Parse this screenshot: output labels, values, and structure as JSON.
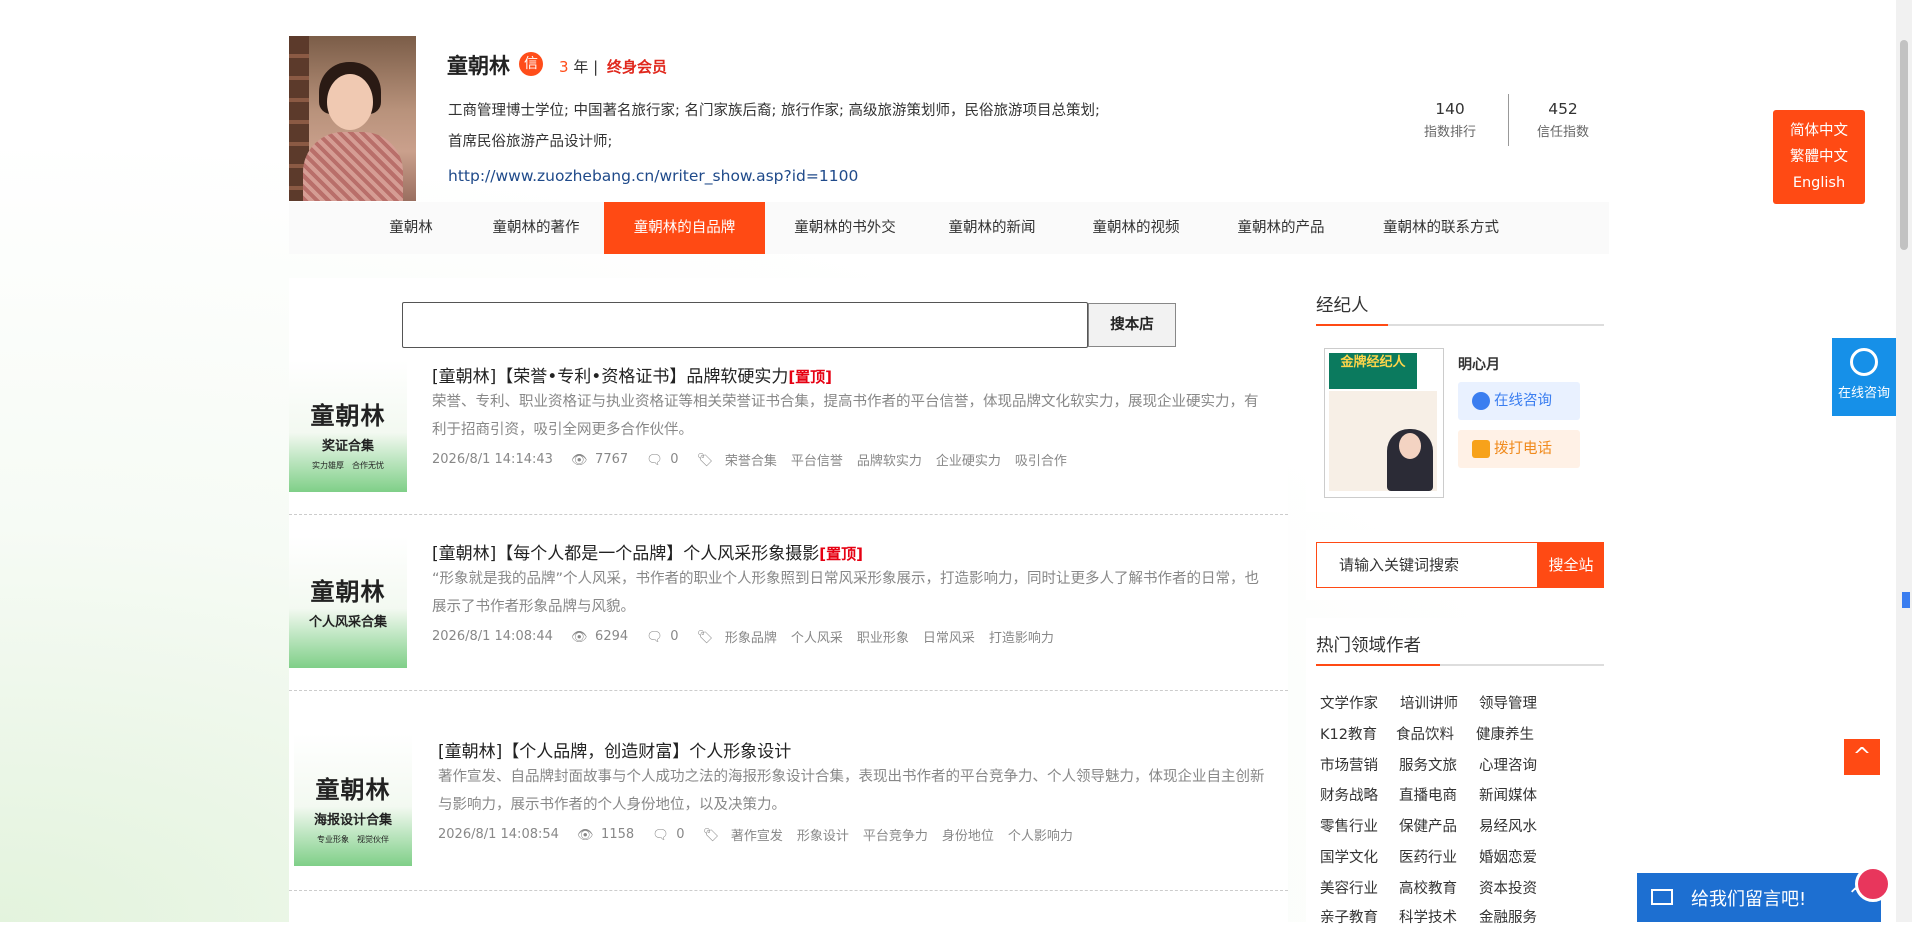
{
  "profile": {
    "name": "童朝林",
    "badge": "信",
    "years_num": "3",
    "years_unit": "年 |",
    "member": "终身会员",
    "bio_line1": "工商管理博士学位; 中国著名旅行家; 名门家族后裔; 旅行作家; 高级旅游策划师，民俗旅游项目总策划;",
    "bio_line2": "首席民俗旅游产品设计师;",
    "url": "http://www.zuozhebang.cn/writer_show.asp?id=1100",
    "stats": [
      {
        "value": "140",
        "label": "指数排行"
      },
      {
        "value": "452",
        "label": "信任指数"
      }
    ]
  },
  "nav": [
    "童朝林",
    "童朝林的著作",
    "童朝林的自品牌",
    "童朝林的书外交",
    "童朝林的新闻",
    "童朝林的视频",
    "童朝林的产品",
    "童朝林的联系方式"
  ],
  "search": {
    "button": "搜本店",
    "placeholder": ""
  },
  "articles": [
    {
      "thumb": {
        "t1": "童朝林",
        "t2": "奖证合集",
        "t3": "实力雄厚　合作无忧"
      },
      "title": "[童朝林]【荣誉•专利•资格证书】品牌软硬实力",
      "pin": "[置顶]",
      "desc": "荣誉、专利、职业资格证与执业资格证等相关荣誉证书合集，提高书作者的平台信誉，体现品牌文化软实力，展现企业硬实力，有利于招商引资，吸引全网更多合作伙伴。",
      "date": "2026/8/1 14:14:43",
      "views": "7767",
      "comments": "0",
      "tags": [
        "荣誉合集",
        "平台信誉",
        "品牌软实力",
        "企业硬实力",
        "吸引合作"
      ]
    },
    {
      "thumb": {
        "t1": "童朝林",
        "t2": "个人风采合集",
        "t3": ""
      },
      "title": "[童朝林]【每个人都是一个品牌】个人风采形象摄影",
      "pin": "[置顶]",
      "desc": "“形象就是我的品牌”个人风采，书作者的职业个人形象照到日常风采形象展示，打造影响力，同时让更多人了解书作者的日常，也展示了书作者形象品牌与风貌。",
      "date": "2026/8/1 14:08:44",
      "views": "6294",
      "comments": "0",
      "tags": [
        "形象品牌",
        "个人风采",
        "职业形象",
        "日常风采",
        "打造影响力"
      ]
    },
    {
      "thumb": {
        "t1": "童朝林",
        "t2": "海报设计合集",
        "t3": "专业形象　视觉伙伴"
      },
      "title": "[童朝林]【个人品牌，创造财富】个人形象设计",
      "pin": "",
      "desc": "著作宣发、自品牌封面故事与个人成功之法的海报形象设计合集，表现出书作者的平台竞争力、个人领导魅力，体现企业自主创新与影响力，展示书作者的个人身份地位，以及决策力。",
      "date": "2026/8/1 14:08:54",
      "views": "1158",
      "comments": "0",
      "tags": [
        "著作宣发",
        "形象设计",
        "平台竞争力",
        "身份地位",
        "个人影响力"
      ]
    }
  ],
  "sidebar": {
    "agent_title": "经纪人",
    "agent_img_text": "金牌经纪人",
    "agent_name": "明心月",
    "consult": "在线咨询",
    "phone": "拨打电话",
    "site_search_placeholder": "请输入关键词搜索",
    "site_search_btn": "搜全站",
    "hot_title": "热门领域作者",
    "hot_tags": [
      "文学作家",
      "培训讲师",
      "领导管理",
      "K12教育",
      "食品饮料",
      "健康养生",
      "市场营销",
      "服务文旅",
      "心理咨询",
      "财务战略",
      "直播电商",
      "新闻媒体",
      "零售行业",
      "保健产品",
      "易经风水",
      "国学文化",
      "医药行业",
      "婚姻恋爱",
      "美容行业",
      "高校教育",
      "资本投资",
      "亲子教育",
      "科学技术",
      "金融服务"
    ]
  },
  "floaters": {
    "lang": [
      "简体中文",
      "繁體中文",
      "English"
    ],
    "kefu": "在线咨询",
    "totop": "^",
    "message": "给我们留言吧!"
  },
  "colors": {
    "accent": "#ff4a14",
    "link": "#1f4a8a",
    "blue": "#1d6fd1"
  }
}
